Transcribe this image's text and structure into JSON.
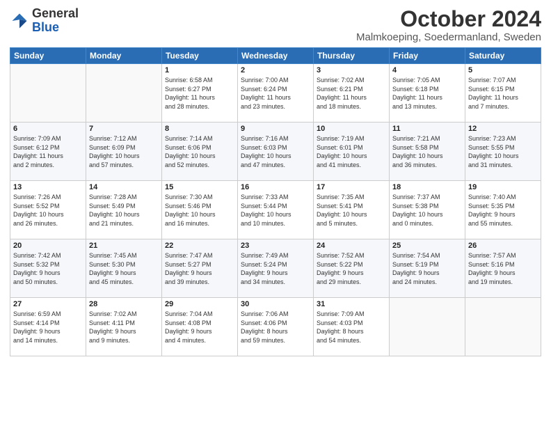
{
  "header": {
    "logo_general": "General",
    "logo_blue": "Blue",
    "month": "October 2024",
    "location": "Malmkoeping, Soedermanland, Sweden"
  },
  "weekdays": [
    "Sunday",
    "Monday",
    "Tuesday",
    "Wednesday",
    "Thursday",
    "Friday",
    "Saturday"
  ],
  "weeks": [
    [
      {
        "day": "",
        "text": ""
      },
      {
        "day": "",
        "text": ""
      },
      {
        "day": "1",
        "text": "Sunrise: 6:58 AM\nSunset: 6:27 PM\nDaylight: 11 hours\nand 28 minutes."
      },
      {
        "day": "2",
        "text": "Sunrise: 7:00 AM\nSunset: 6:24 PM\nDaylight: 11 hours\nand 23 minutes."
      },
      {
        "day": "3",
        "text": "Sunrise: 7:02 AM\nSunset: 6:21 PM\nDaylight: 11 hours\nand 18 minutes."
      },
      {
        "day": "4",
        "text": "Sunrise: 7:05 AM\nSunset: 6:18 PM\nDaylight: 11 hours\nand 13 minutes."
      },
      {
        "day": "5",
        "text": "Sunrise: 7:07 AM\nSunset: 6:15 PM\nDaylight: 11 hours\nand 7 minutes."
      }
    ],
    [
      {
        "day": "6",
        "text": "Sunrise: 7:09 AM\nSunset: 6:12 PM\nDaylight: 11 hours\nand 2 minutes."
      },
      {
        "day": "7",
        "text": "Sunrise: 7:12 AM\nSunset: 6:09 PM\nDaylight: 10 hours\nand 57 minutes."
      },
      {
        "day": "8",
        "text": "Sunrise: 7:14 AM\nSunset: 6:06 PM\nDaylight: 10 hours\nand 52 minutes."
      },
      {
        "day": "9",
        "text": "Sunrise: 7:16 AM\nSunset: 6:03 PM\nDaylight: 10 hours\nand 47 minutes."
      },
      {
        "day": "10",
        "text": "Sunrise: 7:19 AM\nSunset: 6:01 PM\nDaylight: 10 hours\nand 41 minutes."
      },
      {
        "day": "11",
        "text": "Sunrise: 7:21 AM\nSunset: 5:58 PM\nDaylight: 10 hours\nand 36 minutes."
      },
      {
        "day": "12",
        "text": "Sunrise: 7:23 AM\nSunset: 5:55 PM\nDaylight: 10 hours\nand 31 minutes."
      }
    ],
    [
      {
        "day": "13",
        "text": "Sunrise: 7:26 AM\nSunset: 5:52 PM\nDaylight: 10 hours\nand 26 minutes."
      },
      {
        "day": "14",
        "text": "Sunrise: 7:28 AM\nSunset: 5:49 PM\nDaylight: 10 hours\nand 21 minutes."
      },
      {
        "day": "15",
        "text": "Sunrise: 7:30 AM\nSunset: 5:46 PM\nDaylight: 10 hours\nand 16 minutes."
      },
      {
        "day": "16",
        "text": "Sunrise: 7:33 AM\nSunset: 5:44 PM\nDaylight: 10 hours\nand 10 minutes."
      },
      {
        "day": "17",
        "text": "Sunrise: 7:35 AM\nSunset: 5:41 PM\nDaylight: 10 hours\nand 5 minutes."
      },
      {
        "day": "18",
        "text": "Sunrise: 7:37 AM\nSunset: 5:38 PM\nDaylight: 10 hours\nand 0 minutes."
      },
      {
        "day": "19",
        "text": "Sunrise: 7:40 AM\nSunset: 5:35 PM\nDaylight: 9 hours\nand 55 minutes."
      }
    ],
    [
      {
        "day": "20",
        "text": "Sunrise: 7:42 AM\nSunset: 5:32 PM\nDaylight: 9 hours\nand 50 minutes."
      },
      {
        "day": "21",
        "text": "Sunrise: 7:45 AM\nSunset: 5:30 PM\nDaylight: 9 hours\nand 45 minutes."
      },
      {
        "day": "22",
        "text": "Sunrise: 7:47 AM\nSunset: 5:27 PM\nDaylight: 9 hours\nand 39 minutes."
      },
      {
        "day": "23",
        "text": "Sunrise: 7:49 AM\nSunset: 5:24 PM\nDaylight: 9 hours\nand 34 minutes."
      },
      {
        "day": "24",
        "text": "Sunrise: 7:52 AM\nSunset: 5:22 PM\nDaylight: 9 hours\nand 29 minutes."
      },
      {
        "day": "25",
        "text": "Sunrise: 7:54 AM\nSunset: 5:19 PM\nDaylight: 9 hours\nand 24 minutes."
      },
      {
        "day": "26",
        "text": "Sunrise: 7:57 AM\nSunset: 5:16 PM\nDaylight: 9 hours\nand 19 minutes."
      }
    ],
    [
      {
        "day": "27",
        "text": "Sunrise: 6:59 AM\nSunset: 4:14 PM\nDaylight: 9 hours\nand 14 minutes."
      },
      {
        "day": "28",
        "text": "Sunrise: 7:02 AM\nSunset: 4:11 PM\nDaylight: 9 hours\nand 9 minutes."
      },
      {
        "day": "29",
        "text": "Sunrise: 7:04 AM\nSunset: 4:08 PM\nDaylight: 9 hours\nand 4 minutes."
      },
      {
        "day": "30",
        "text": "Sunrise: 7:06 AM\nSunset: 4:06 PM\nDaylight: 8 hours\nand 59 minutes."
      },
      {
        "day": "31",
        "text": "Sunrise: 7:09 AM\nSunset: 4:03 PM\nDaylight: 8 hours\nand 54 minutes."
      },
      {
        "day": "",
        "text": ""
      },
      {
        "day": "",
        "text": ""
      }
    ]
  ]
}
